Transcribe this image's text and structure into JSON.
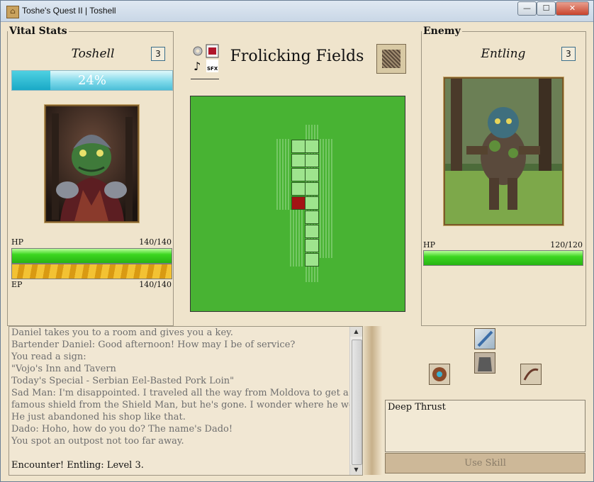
{
  "window": {
    "title": "Toshe's Quest II | Toshell",
    "minimize": "—",
    "maximize": "☐",
    "close": "✕"
  },
  "player": {
    "section_title": "Vital Stats",
    "name": "Toshell",
    "level": "3",
    "xp_percent_text": "24%",
    "xp_fraction": 0.24,
    "hp_label": "HP",
    "hp_text": "140/140",
    "ep_label": "EP",
    "ep_text": "140/140"
  },
  "area": {
    "name": "Frolicking Fields",
    "options_icons": [
      "settings-icon",
      "battle-music-icon",
      "music-toggle-icon",
      "sfx-toggle-icon"
    ]
  },
  "enemy": {
    "section_title": "Enemy",
    "name": "Entling",
    "level": "3",
    "hp_label": "HP",
    "hp_text": "120/120"
  },
  "log": {
    "lines": [
      "Daniel takes you to a room and gives you a key.",
      "Bartender Daniel: Good afternoon! How may I be of service?",
      "You read a sign:",
      "\"Vojo's Inn and Tavern",
      "Today's Special - Serbian Eel-Basted Pork Loin\"",
      "Sad Man: I'm disappointed. I traveled all the way from Moldova to get a world",
      "famous shield from the Shield Man, but he's gone. I wonder where he would go.",
      "He just abandoned his shop like that.",
      "Dado: Hoho, how do you do? The name's Dado!",
      "You spot an outpost not too far away.",
      "",
      "Encounter! Entling: Level 3."
    ],
    "active_line": "Encounter! Entling: Level 3."
  },
  "skills": {
    "selected_name": "Deep Thrust",
    "use_button": "Use Skill",
    "slots": [
      "sword-skill-icon",
      "shield-skill-icon",
      "armor-skill-icon",
      "weapon-skill-icon"
    ]
  }
}
